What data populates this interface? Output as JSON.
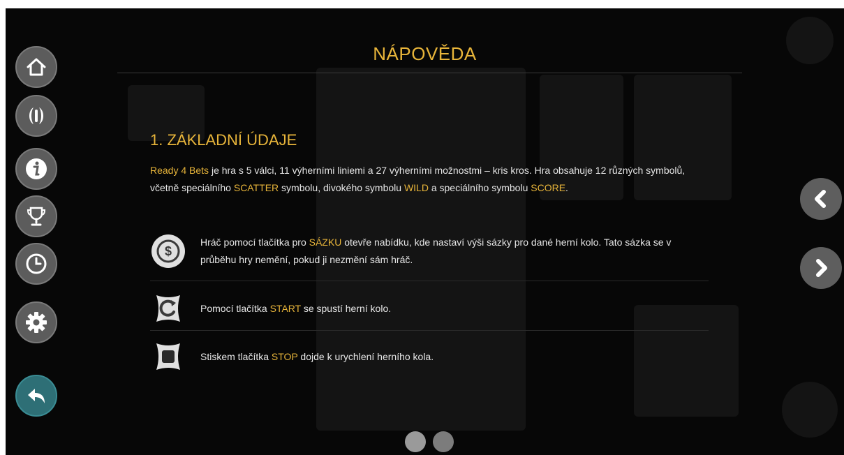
{
  "title": "NÁPOVĚDA",
  "section": {
    "heading": "1. ZÁKLADNÍ ÚDAJE",
    "intro": {
      "game_name": "Ready 4 Bets",
      "t1": " je hra s 5 válci, 11 výherními liniemi a 27 výherními možnostmi – kris kros. Hra obsahuje 12 různých symbolů, včetně speciálního ",
      "scatter": "SCATTER",
      "t2": " symbolu, divokého symbolu ",
      "wild": "WILD",
      "t3": " a speciálního symbolu ",
      "score": "SCORE",
      "t4": "."
    },
    "items": [
      {
        "icon": "dollar-coin-icon",
        "pre": "Hráč pomocí tlačítka pro ",
        "key": "SÁZKU",
        "post": " otevře nabídku, kde nastaví výši sázky pro dané herní kolo. Tato sázka se v průběhu hry nemění, pokud ji nezmění sám hráč."
      },
      {
        "icon": "start-refresh-icon",
        "pre": "Pomocí tlačítka ",
        "key": "START",
        "post": " se spustí herní kolo."
      },
      {
        "icon": "stop-square-icon",
        "pre": "Stiskem tlačítka ",
        "key": "STOP",
        "post": " dojde k urychlení herního kola."
      }
    ]
  },
  "left_rail": [
    "home-icon",
    "wings-icon",
    "info-icon",
    "trophy-icon",
    "history-clock-icon",
    "settings-gear-icon",
    "back-arrow-icon"
  ],
  "right_nav": [
    "arrow-left-icon",
    "arrow-right-icon"
  ],
  "pagination": {
    "pages": 2,
    "current": 1
  },
  "colors": {
    "accent": "#e8b53a",
    "text": "#e6e6e6",
    "background": "#070707",
    "button": "#5c5c5c",
    "back_button": "#2e6f76"
  }
}
